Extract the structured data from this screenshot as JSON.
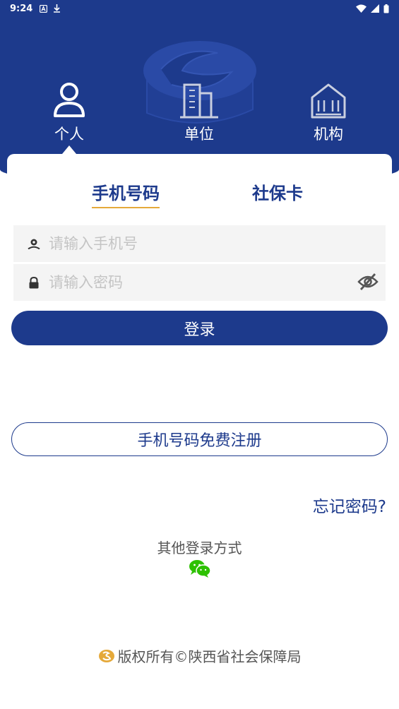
{
  "status_bar": {
    "time": "9:24",
    "left_icons": [
      "notification-a-icon",
      "download-icon"
    ],
    "right_icons": [
      "wifi-icon",
      "signal-icon",
      "battery-icon"
    ]
  },
  "role_tabs": [
    {
      "label": "个人",
      "icon": "person-icon",
      "selected": true
    },
    {
      "label": "单位",
      "icon": "office-building-icon",
      "selected": false
    },
    {
      "label": "机构",
      "icon": "institution-building-icon",
      "selected": false
    }
  ],
  "login_tabs": [
    {
      "label": "手机号码",
      "selected": true
    },
    {
      "label": "社保卡",
      "selected": false
    }
  ],
  "form": {
    "phone_placeholder": "请输入手机号",
    "phone_value": "",
    "password_placeholder": "请输入密码",
    "password_value": ""
  },
  "buttons": {
    "login": "登录",
    "register": "手机号码免费注册",
    "forgot": "忘记密码?"
  },
  "other_login": {
    "label": "其他登录方式",
    "icon": "wechat-icon"
  },
  "footer": {
    "text": "版权所有©陕西省社会保障局",
    "logo_icon": "social-insurance-logo-icon"
  },
  "colors": {
    "primary": "#1d3a8c",
    "accent": "#e5a93a",
    "wechat": "#2dc100"
  }
}
